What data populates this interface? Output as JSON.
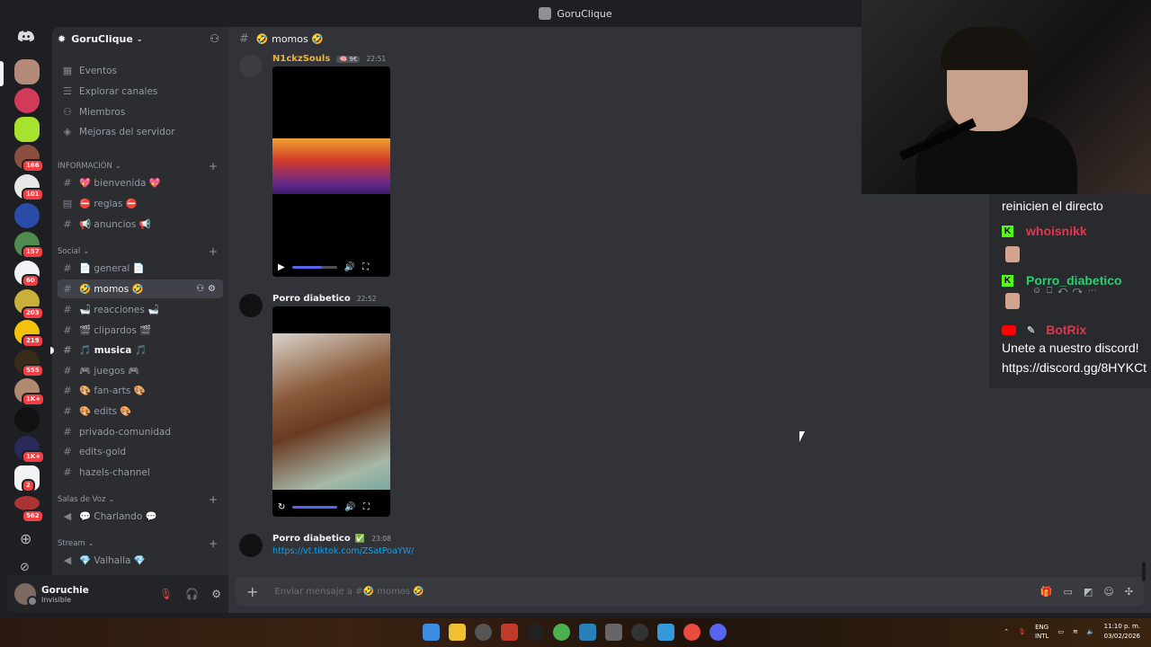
{
  "window": {
    "title": "GoruClique"
  },
  "server_rail": {
    "badges": [
      "166",
      "101",
      "157",
      "60",
      "203",
      "219",
      "555",
      "1K+",
      "1K+",
      "2",
      "562"
    ]
  },
  "sidebar": {
    "server_name": "GoruClique",
    "top_items": [
      {
        "label": "Eventos",
        "icon": "calendar-icon"
      },
      {
        "label": "Explorar canales",
        "icon": "browse-icon"
      },
      {
        "label": "Miembros",
        "icon": "members-icon"
      },
      {
        "label": "Mejoras del servidor",
        "icon": "boost-icon"
      }
    ],
    "categories": [
      {
        "name": "INFORMACIÓN"
      },
      {
        "name": "Social"
      },
      {
        "name": "Salas de Voz"
      },
      {
        "name": "Stream"
      }
    ],
    "channels": {
      "bienvenida": "💖 bienvenida 💖",
      "reglas": "⛔ reglas ⛔",
      "anuncios": "📢 anuncios 📢",
      "general": "📄 general 📄",
      "momos": "🤣 momos 🤣",
      "reacciones": "🛁 reacciones 🛁",
      "clipardos": "🎬 clipardos 🎬",
      "musica": "🎵 musica 🎵",
      "juegos": "🎮 juegos 🎮",
      "fan_arts": "🎨 fan-arts 🎨",
      "edits": "🎨 edits 🎨",
      "privado": "privado-comunidad",
      "edits_gold": "edits-gold",
      "hazels": "hazels-channel",
      "charlando": "💬 Charlando 💬",
      "valhalla": "💎 Valhalla 💎"
    }
  },
  "user_panel": {
    "username": "Goruchie",
    "status": "Invisible"
  },
  "chat": {
    "channel_title": "🤣 momos 🤣",
    "messages": [
      {
        "author": "N1ckzSouls",
        "tag": "🧠 9€",
        "time": "22:51"
      },
      {
        "author": "Porro diabetico",
        "time": "22:52"
      },
      {
        "author": "Porro diabetico",
        "badge": "✅",
        "time": "23:08",
        "link": "https://vt.tiktok.com/ZSatPoaYW/"
      }
    ],
    "composer_placeholder": "Enviar mensaje a #🤣 momos 🤣"
  },
  "stream_chat": {
    "lines": [
      {
        "text": "reinicien el directo"
      },
      {
        "user": "whoisnikk",
        "color": "#e8344c"
      },
      {
        "user": "Porro_diabetico",
        "color": "#2ecc71"
      },
      {
        "user": "BotRix",
        "color": "#e8344c"
      },
      {
        "text": "Unete a nuestro discord!"
      },
      {
        "text": "https://discord.gg/8HYKCt"
      }
    ]
  },
  "taskbar": {
    "lang1": "ENG",
    "lang2": "INTL",
    "time": "11:10 p. m.",
    "date": "03/02/2026"
  }
}
